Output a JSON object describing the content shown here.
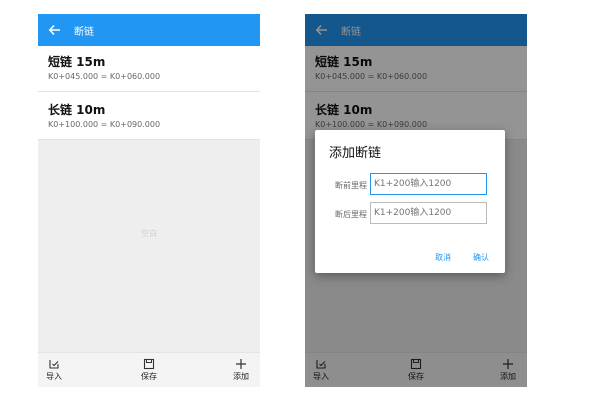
{
  "header": {
    "title": "断链"
  },
  "items": [
    {
      "title": "短链 15m",
      "subtitle": "K0+045.000 = K0+060.000"
    },
    {
      "title": "长链 10m",
      "subtitle": "K0+100.000 = K0+090.000"
    }
  ],
  "empty_text": "空白",
  "toolbar": {
    "import_label": "导入",
    "save_label": "保存",
    "add_label": "添加"
  },
  "dialog": {
    "title": "添加断链",
    "before_label": "断前里程",
    "before_placeholder": "K1+200输入1200",
    "after_label": "断后里程",
    "after_placeholder": "K1+200输入1200",
    "cancel_label": "取消",
    "confirm_label": "确认"
  },
  "colors": {
    "accent": "#2196f3",
    "dim_overlay": "rgba(0,0,0,0.42)"
  }
}
